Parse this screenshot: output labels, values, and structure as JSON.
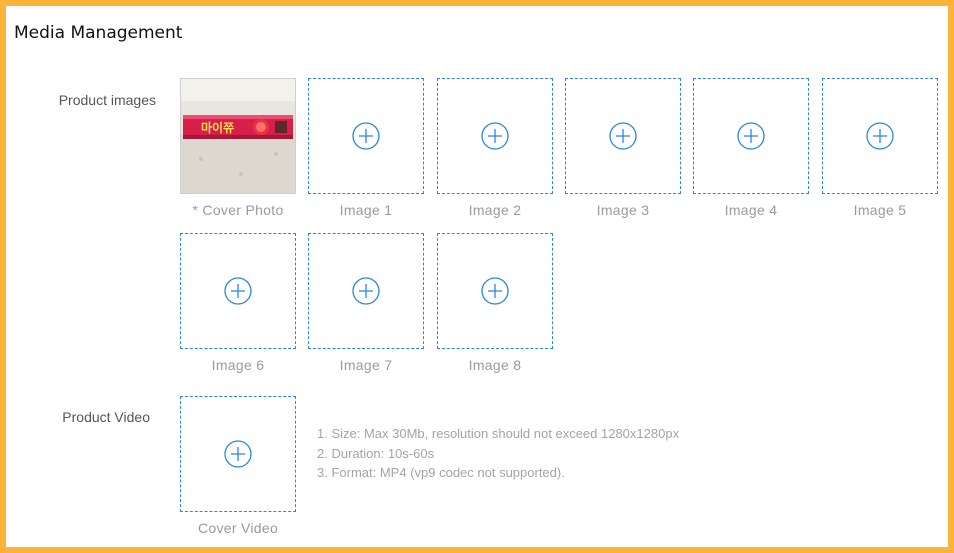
{
  "section": {
    "title": "Media Management"
  },
  "product_images": {
    "label": "Product images",
    "cover": {
      "caption": "* Cover Photo",
      "product_text": "마이쮸"
    },
    "slots": [
      {
        "caption": "Image  1"
      },
      {
        "caption": "Image  2"
      },
      {
        "caption": "Image  3"
      },
      {
        "caption": "Image  4"
      },
      {
        "caption": "Image  5"
      },
      {
        "caption": "Image  6"
      },
      {
        "caption": "Image  7"
      },
      {
        "caption": "Image  8"
      }
    ]
  },
  "product_video": {
    "label": "Product Video",
    "cover_caption": "Cover Video",
    "hints": [
      "1. Size: Max 30Mb, resolution should not exceed 1280x1280px",
      "2. Duration: 10s-60s",
      "3. Format: MP4 (vp9 codec not supported)."
    ]
  },
  "colors": {
    "frame": "#FBB33A",
    "accent": "#2B87D8"
  },
  "icons": {
    "upload": "plus-circle-icon"
  }
}
